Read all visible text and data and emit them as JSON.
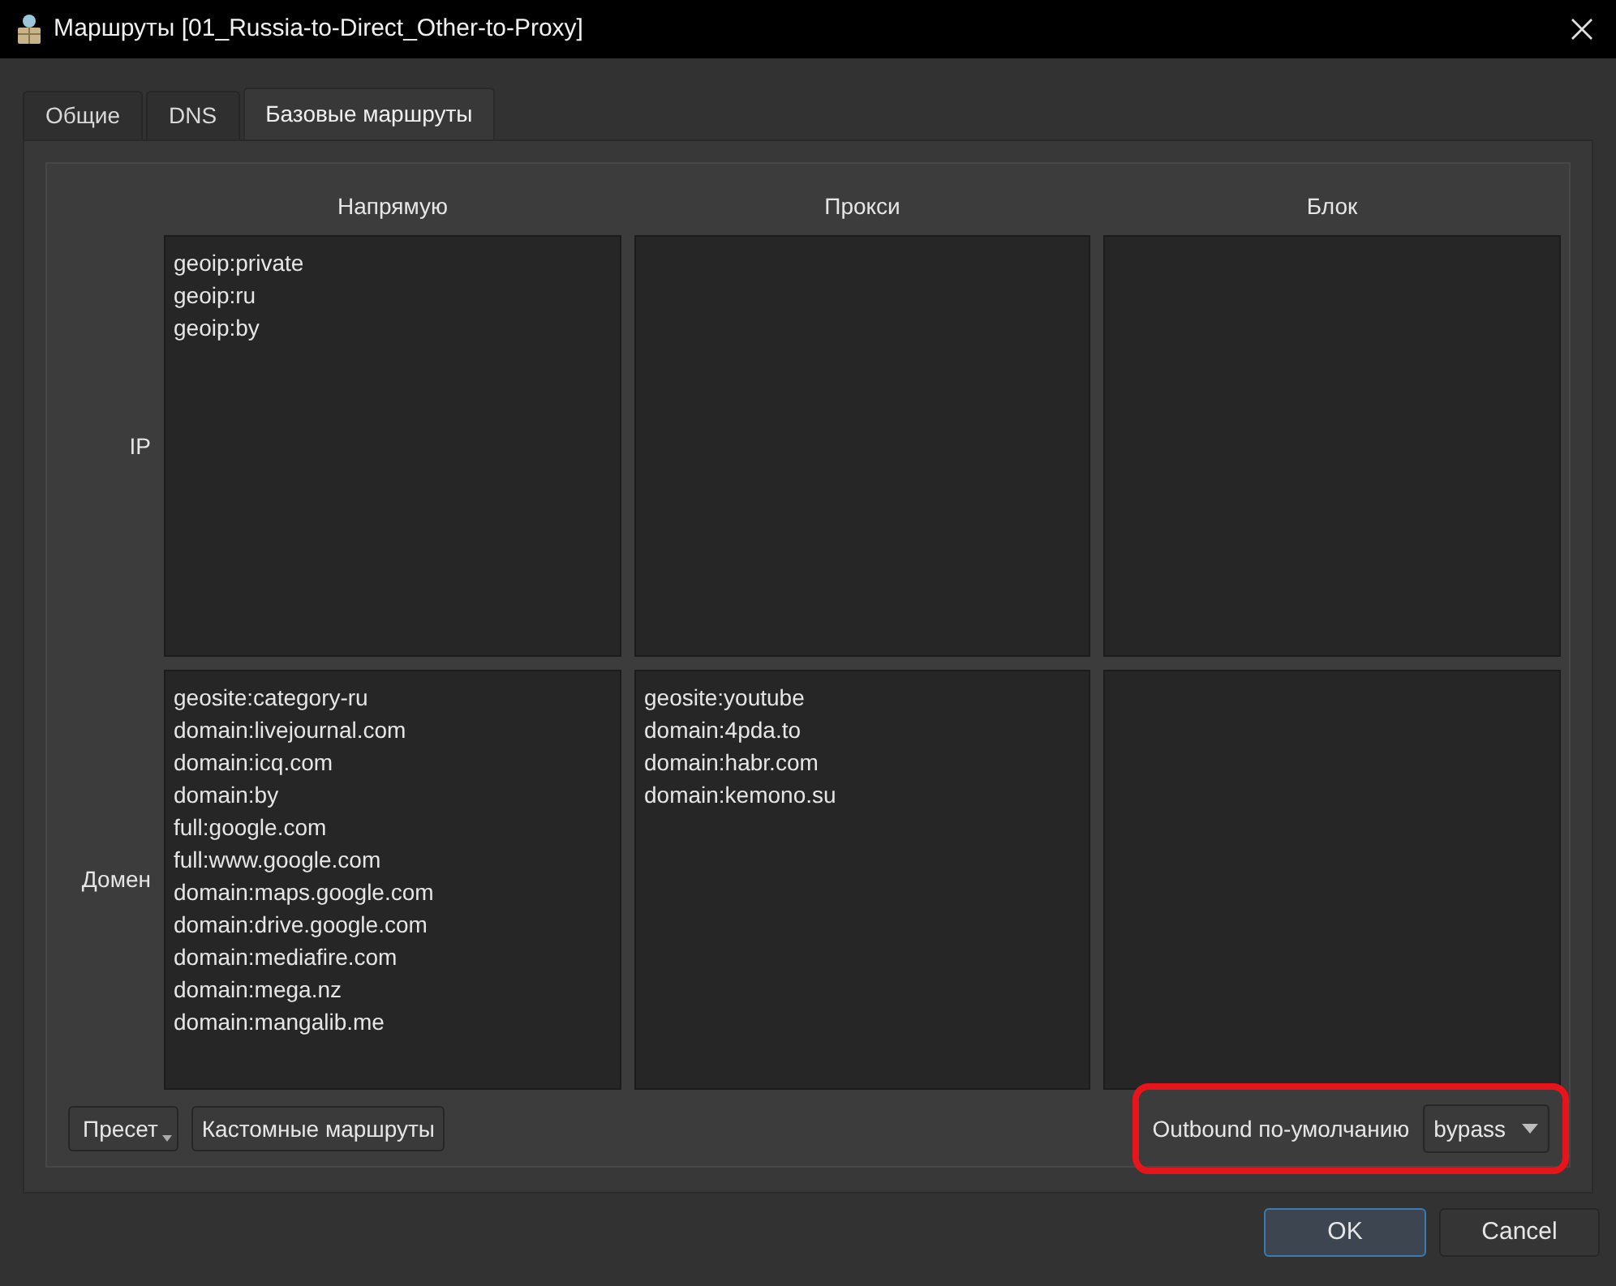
{
  "window": {
    "title": "Маршруты [01_Russia-to-Direct_Other-to-Proxy]"
  },
  "tabs": [
    {
      "label": "Общие",
      "selected": false
    },
    {
      "label": "DNS",
      "selected": false
    },
    {
      "label": "Базовые маршруты",
      "selected": true
    }
  ],
  "columns": [
    "Напрямую",
    "Прокси",
    "Блок"
  ],
  "rows": [
    {
      "label": "IP",
      "cells": [
        [
          "geoip:private",
          "geoip:ru",
          "geoip:by"
        ],
        [],
        []
      ]
    },
    {
      "label": "Домен",
      "cells": [
        [
          "geosite:category-ru",
          "domain:livejournal.com",
          "domain:icq.com",
          "domain:by",
          "full:google.com",
          "full:www.google.com",
          "domain:maps.google.com",
          "domain:drive.google.com",
          "domain:mediafire.com",
          "domain:mega.nz",
          "domain:mangalib.me"
        ],
        [
          "geosite:youtube",
          "domain:4pda.to",
          "domain:habr.com",
          "domain:kemono.su"
        ],
        []
      ]
    }
  ],
  "left_buttons": [
    {
      "label": "Пресет",
      "kind": "menu"
    },
    {
      "label": "Кастомные маршруты",
      "kind": "plain"
    }
  ],
  "outbound": {
    "label": "Outbound по-умолчанию",
    "value": "bypass"
  },
  "dialog_buttons": [
    {
      "label": "OK",
      "default": true
    },
    {
      "label": "Cancel",
      "default": false
    }
  ]
}
